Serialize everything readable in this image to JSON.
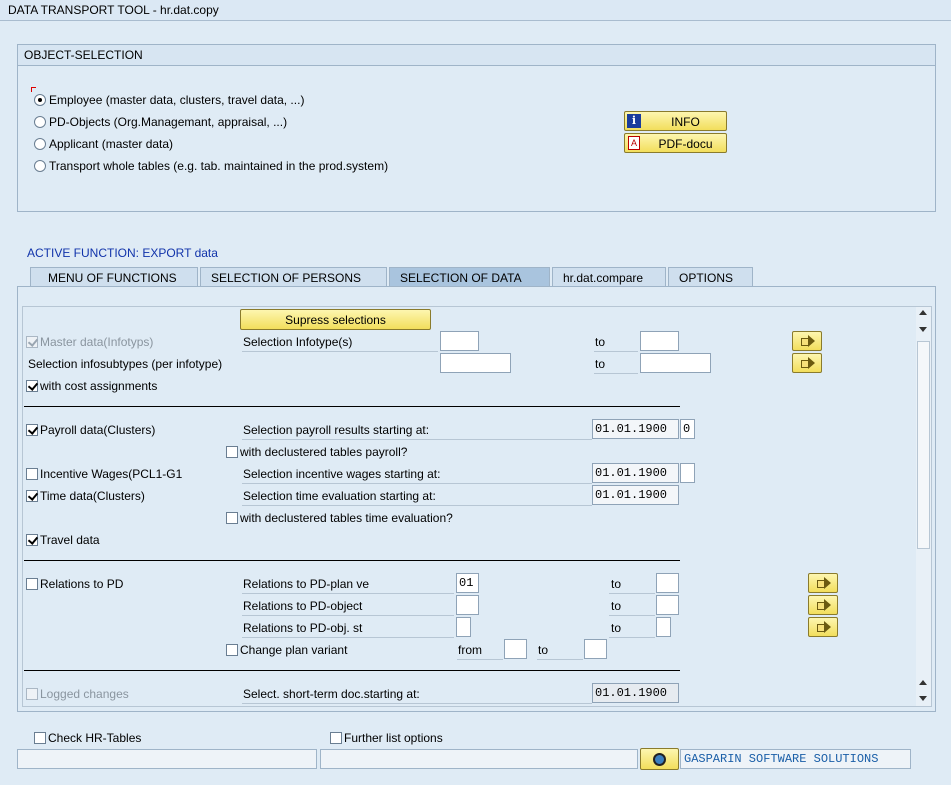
{
  "window": {
    "title": "DATA TRANSPORT TOOL - hr.dat.copy"
  },
  "object_selection": {
    "title": "OBJECT-SELECTION",
    "options": [
      {
        "label": "Employee (master data, clusters, travel data, ...)",
        "selected": true
      },
      {
        "label": "PD-Objects (Org.Managemant, appraisal, ...)",
        "selected": false
      },
      {
        "label": "Applicant (master data)",
        "selected": false
      },
      {
        "label": "Transport whole tables (e.g. tab. maintained in the prod.system)",
        "selected": false
      }
    ],
    "info_button": "INFO",
    "pdf_button": "PDF-docu"
  },
  "active_function": "ACTIVE FUNCTION: EXPORT data",
  "tabs": [
    {
      "label": "MENU OF FUNCTIONS",
      "active": false
    },
    {
      "label": "SELECTION OF PERSONS",
      "active": false
    },
    {
      "label": "SELECTION OF DATA",
      "active": true
    },
    {
      "label": "hr.dat.compare",
      "active": false
    },
    {
      "label": "OPTIONS",
      "active": false
    }
  ],
  "selection": {
    "supress_button": "Supress selections",
    "master_data": {
      "label": "Master data(Infotyps)",
      "checked": true,
      "disabled": true
    },
    "sel_infotype": "Selection Infotype(s)",
    "to": "to",
    "sel_subtypes": "Selection infosubtypes (per infotype)",
    "cost_assign": {
      "label": "with cost assignments",
      "checked": true
    },
    "payroll": {
      "label": "Payroll data(Clusters)",
      "checked": true
    },
    "payroll_sel": "Selection payroll results starting at:",
    "payroll_date": "01.01.1900",
    "payroll_extra": "0",
    "declustered_payroll": {
      "label": "with declustered tables payroll?",
      "checked": false
    },
    "incentive": {
      "label": "Incentive Wages(PCL1-G1",
      "checked": false
    },
    "incentive_sel": "Selection incentive wages starting at:",
    "incentive_date": "01.01.1900",
    "time_data": {
      "label": "Time data(Clusters)",
      "checked": true
    },
    "time_sel": "Selection time evaluation starting at:",
    "time_date": "01.01.1900",
    "declustered_time": {
      "label": "with declustered tables time evaluation?",
      "checked": false
    },
    "travel": {
      "label": "Travel data",
      "checked": true
    },
    "relations": {
      "label": "Relations to PD",
      "checked": false
    },
    "rel_plan": "Relations to PD-plan ve",
    "rel_plan_value": "01",
    "rel_object": "Relations to PD-object",
    "rel_status": "Relations to PD-obj. st",
    "change_plan": {
      "label": "Change plan variant",
      "checked": false
    },
    "from": "from",
    "logged": {
      "label": "Logged changes",
      "checked": false,
      "disabled": true
    },
    "logged_sel": "Select. short-term doc.starting at:",
    "logged_date": "01.01.1900"
  },
  "bottom": {
    "check_hr": {
      "label": "Check HR-Tables",
      "checked": false
    },
    "further": {
      "label": "Further list options",
      "checked": false
    },
    "brand": "GASPARIN SOFTWARE SOLUTIONS"
  }
}
